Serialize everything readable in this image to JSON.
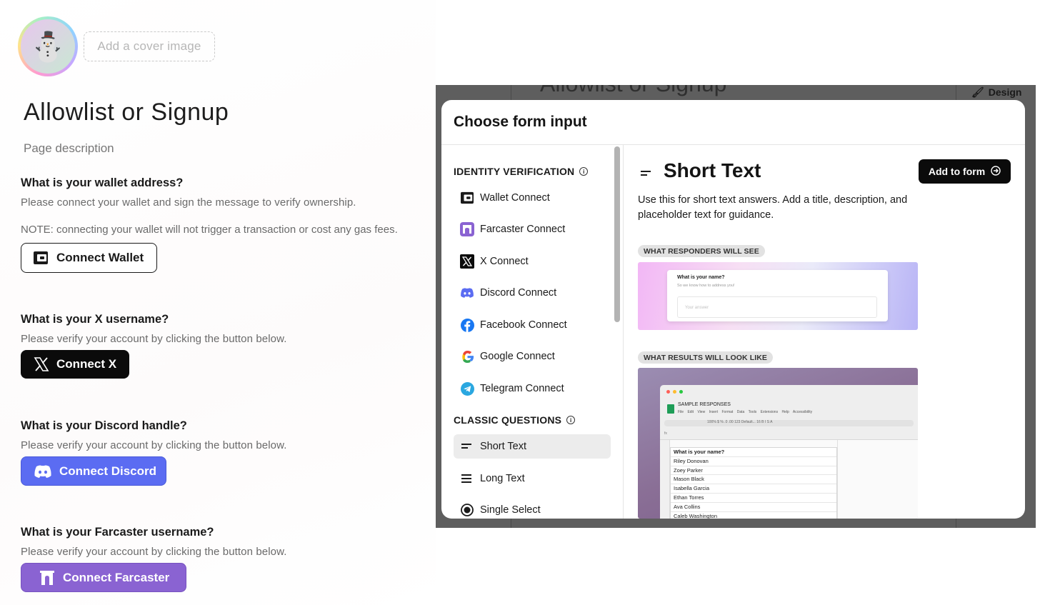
{
  "page": {
    "cover_button": "Add a cover image",
    "title": "Allowlist or Signup",
    "description": "Page description"
  },
  "questions": [
    {
      "title": "What is your wallet address?",
      "subtitle": "Please connect your wallet and sign the message to verify ownership.",
      "note": "NOTE: connecting your wallet will not trigger a transaction or cost any gas fees.",
      "button": "Connect Wallet"
    },
    {
      "title": "What is your X username?",
      "subtitle": "Please verify your account by clicking the button below.",
      "button": "Connect X"
    },
    {
      "title": "What is your Discord handle?",
      "subtitle": "Please verify your account by clicking the button below.",
      "button": "Connect Discord"
    },
    {
      "title": "What is your Farcaster username?",
      "subtitle": "Please verify your account by clicking the button below.",
      "button": "Connect Farcaster"
    }
  ],
  "editor_bg": {
    "title": "Allowlist or Signup",
    "design_tab": "Design"
  },
  "modal": {
    "title": "Choose form input",
    "sections": [
      {
        "heading": "IDENTITY VERIFICATION",
        "items": [
          "Wallet Connect",
          "Farcaster Connect",
          "X Connect",
          "Discord Connect",
          "Facebook Connect",
          "Google Connect",
          "Telegram Connect"
        ]
      },
      {
        "heading": "CLASSIC QUESTIONS",
        "items": [
          "Short Text",
          "Long Text",
          "Single Select"
        ]
      }
    ],
    "selected": "Short Text",
    "detail": {
      "title": "Short Text",
      "add_button": "Add to form",
      "description": "Use this for short text answers. Add a title, description, and placeholder text for guidance.",
      "preview_label": "WHAT RESPONDERS WILL SEE",
      "results_label": "WHAT RESULTS WILL LOOK LIKE",
      "preview": {
        "question": "What is your name?",
        "subtitle": "So we know how to address you!",
        "placeholder": "Your answer"
      },
      "sheet": {
        "name": "SAMPLE RESPONSES",
        "menu": "File Edit View Insert Format Data Tools Extensions Help Accessibility",
        "toolbar": "100%  $  %  .0  .00  123  Default...  16  B  I  S  A",
        "header": "What is your name?",
        "rows": [
          "Riley Donovan",
          "Zoey Parker",
          "Mason Black",
          "Isabella Garcia",
          "Ethan Torres",
          "Ava Collins",
          "Caleb Washington"
        ]
      }
    }
  },
  "colors": {
    "discord": "#5b6cf2",
    "farcaster": "#8a63d2",
    "black": "#0b0b0b"
  }
}
